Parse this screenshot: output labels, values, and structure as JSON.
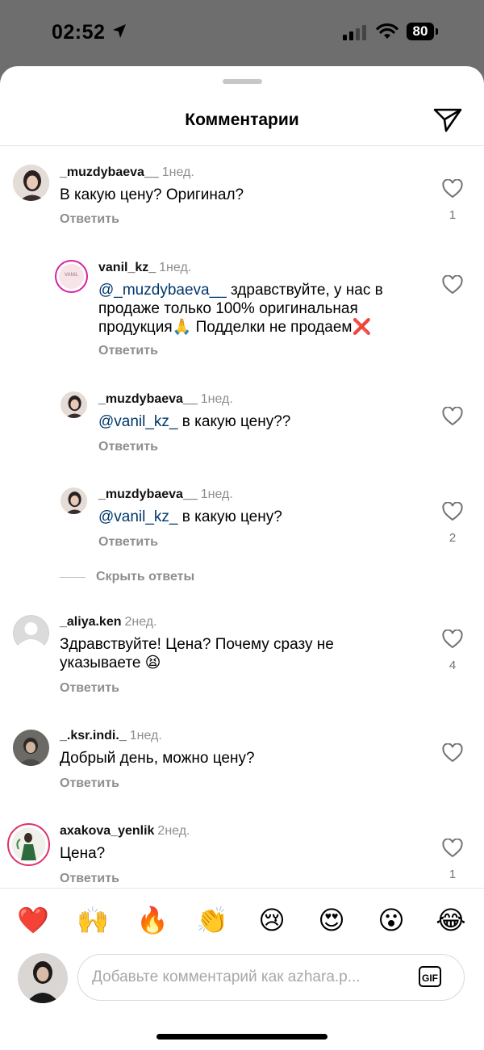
{
  "status_bar": {
    "time": "02:52",
    "battery": "80"
  },
  "header": {
    "title": "Комментарии"
  },
  "comments": [
    {
      "user": "_muzdybaeva__",
      "time": "1нед.",
      "text": "В какую цену? Оригинал?",
      "reply": "Ответить",
      "likes": "1"
    },
    {
      "user": "vanil_kz_",
      "time": "1нед.",
      "mention": "@_muzdybaeva__",
      "text": " здравствуйте, у нас в продаже только 100% оригинальная продукция🙏 Подделки не продаем❌",
      "reply": "Ответить",
      "likes": ""
    },
    {
      "user": "_muzdybaeva__",
      "time": "1нед.",
      "mention": "@vanil_kz_",
      "text": " в какую цену??",
      "reply": "Ответить",
      "likes": ""
    },
    {
      "user": "_muzdybaeva__",
      "time": "1нед.",
      "mention": "@vanil_kz_",
      "text": " в какую цену?",
      "reply": "Ответить",
      "likes": "2"
    },
    {
      "user": "_aliya.ken",
      "time": "2нед.",
      "text": "Здравствуйте! Цена? Почему сразу не указываете 😫",
      "reply": "Ответить",
      "likes": "4"
    },
    {
      "user": "_.ksr.indi._",
      "time": "1нед.",
      "text": "Добрый день, можно цену?",
      "reply": "Ответить",
      "likes": ""
    },
    {
      "user": "axakova_yenlik",
      "time": "2нед.",
      "text": "Цена?",
      "reply": "Ответить",
      "likes": "1"
    }
  ],
  "hide_replies": "Скрыть ответы",
  "vanil_logo_text": "VANIL",
  "emojis": [
    "❤️",
    "🙌",
    "🔥",
    "👏",
    "😢",
    "😍",
    "😮",
    "😂"
  ],
  "composer": {
    "placeholder": "Добавьте комментарий как azhara.p...",
    "gif_label": "GIF"
  },
  "colors": {
    "mention": "#00376b",
    "muted": "#8e8e8e",
    "heart_red": "#e0245e"
  }
}
